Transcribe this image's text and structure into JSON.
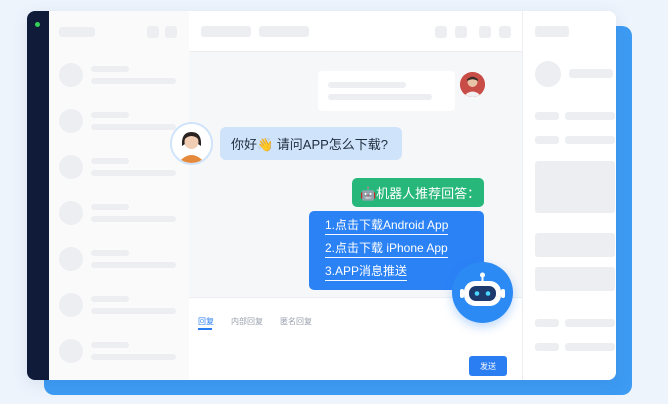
{
  "window": {
    "accent": "#2a7ef2",
    "status_dot": "#34d058"
  },
  "chat": {
    "customer_message": "你好👋 请问APP怎么下载?",
    "robot_header": "🤖机器人推荐回答：",
    "robot_answers": [
      "1.点击下载Android App",
      "2.点击下载 iPhone App",
      "3.APP消息推送"
    ]
  },
  "composer": {
    "tabs": [
      "回复",
      "内部回复",
      "匿名回复"
    ],
    "send_label": "发送"
  },
  "colors": {
    "customer_bubble": "#cfe3fb",
    "robot_header": "#27b77a",
    "robot_answer": "#2b82f5"
  },
  "icons": {
    "robot_avatar": "robot-icon",
    "wave": "waving-hand"
  }
}
